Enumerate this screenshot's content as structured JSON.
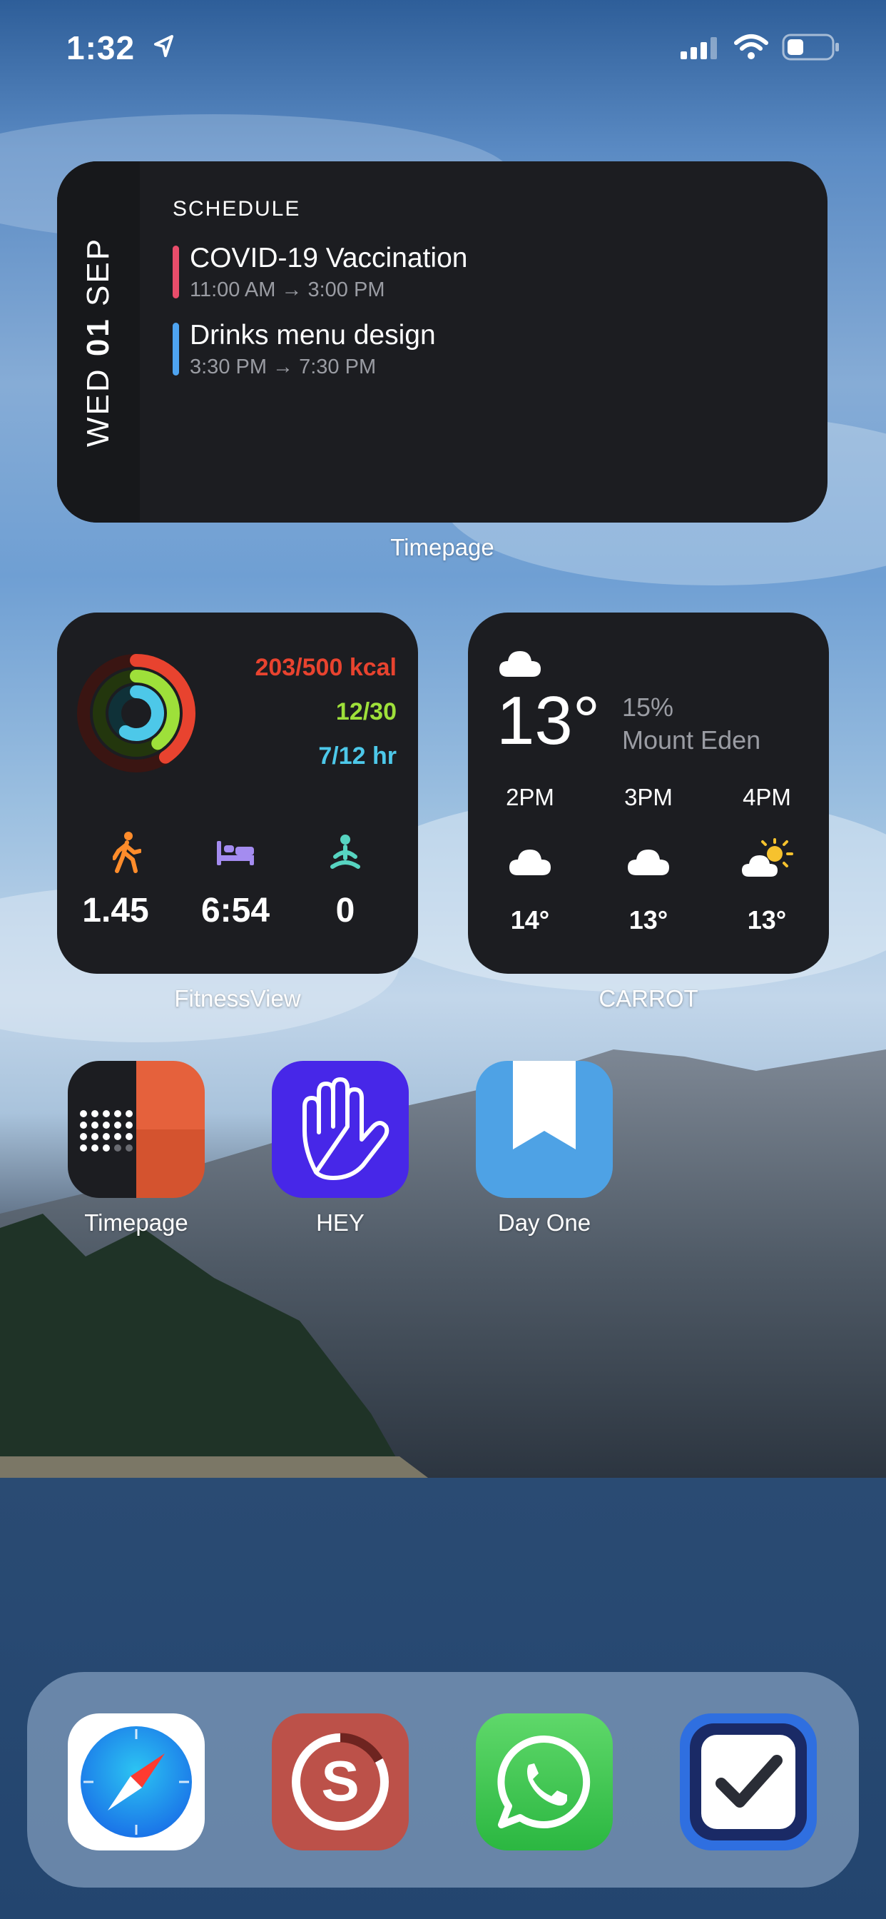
{
  "status_bar": {
    "time": "1:32"
  },
  "timepage_widget": {
    "day": "WED",
    "date": "01",
    "month": "SEP",
    "heading": "SCHEDULE",
    "events": [
      {
        "title": "COVID-19 Vaccination",
        "time": "11:00 AM → 3:00 PM",
        "color": "#e94d6b"
      },
      {
        "title": "Drinks menu design",
        "time": "3:30 PM → 7:30 PM",
        "color": "#4ea3f0"
      }
    ],
    "caption": "Timepage"
  },
  "fitness_widget": {
    "move": "203/500 kcal",
    "exercise": "12/30",
    "stand": "7/12 hr",
    "distance": "1.45",
    "sleep": "6:54",
    "mindful": "0",
    "caption": "FitnessView",
    "colors": {
      "move": "#e8432f",
      "exercise": "#9ee03a",
      "stand": "#4dc8e9",
      "walk": "#ff8c2b",
      "sleep": "#a48cf0",
      "mindful": "#57d4c1"
    }
  },
  "weather_widget": {
    "temp": "13°",
    "precip": "15%",
    "location": "Mount Eden",
    "hours": [
      {
        "label": "2PM",
        "temp": "14°",
        "icon": "cloud-icon"
      },
      {
        "label": "3PM",
        "temp": "13°",
        "icon": "cloud-icon"
      },
      {
        "label": "4PM",
        "temp": "13°",
        "icon": "partly-sunny-icon"
      }
    ],
    "caption": "CARROT"
  },
  "apps": [
    {
      "label": "Timepage",
      "icon": "timepage-icon"
    },
    {
      "label": "HEY",
      "icon": "hey-icon"
    },
    {
      "label": "Day One",
      "icon": "day-one-icon"
    }
  ],
  "dock": [
    {
      "icon": "safari-icon"
    },
    {
      "icon": "spendee-icon"
    },
    {
      "icon": "whatsapp-icon"
    },
    {
      "icon": "things-icon"
    }
  ]
}
